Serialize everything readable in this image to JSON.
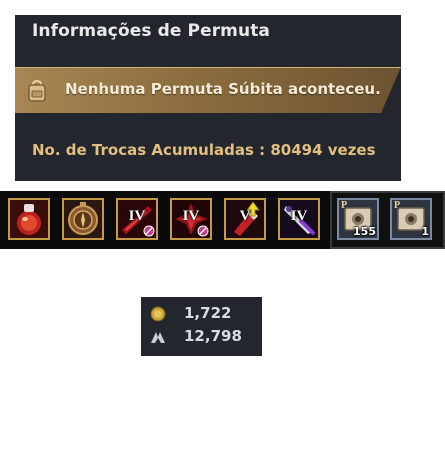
{
  "trade_info": {
    "title": "Informações de Permuta",
    "status_message": "Nenhuma Permuta Súbita aconteceu.",
    "accumulated_trades": "No. de Trocas Acumuladas : 80494 vezes"
  },
  "item_slots": [
    {
      "icon": "red-potion-flask-icon",
      "roman": "",
      "quantity": ""
    },
    {
      "icon": "bronze-compass-icon",
      "roman": "",
      "quantity": ""
    },
    {
      "icon": "red-scroll-icon",
      "roman": "IV",
      "quantity": ""
    },
    {
      "icon": "red-crystal-icon",
      "roman": "IV",
      "quantity": ""
    },
    {
      "icon": "red-vial-icon",
      "roman": "V",
      "quantity": ""
    },
    {
      "icon": "purple-dagger-icon",
      "roman": "IV",
      "quantity": ""
    }
  ],
  "grouped_slots": [
    {
      "icon": "trade-map-scroll-icon",
      "mark": "P",
      "quantity": "155"
    },
    {
      "icon": "trade-map-scroll-icon",
      "mark": "P",
      "quantity": "1"
    }
  ],
  "currency": {
    "silver": "1,722",
    "crow_coin": "12,798"
  },
  "colors": {
    "panel_bg": "#24262d",
    "banner_gold": "#a78653",
    "counter_gold": "#e0bf7f",
    "slot_border": "#c49a42"
  }
}
